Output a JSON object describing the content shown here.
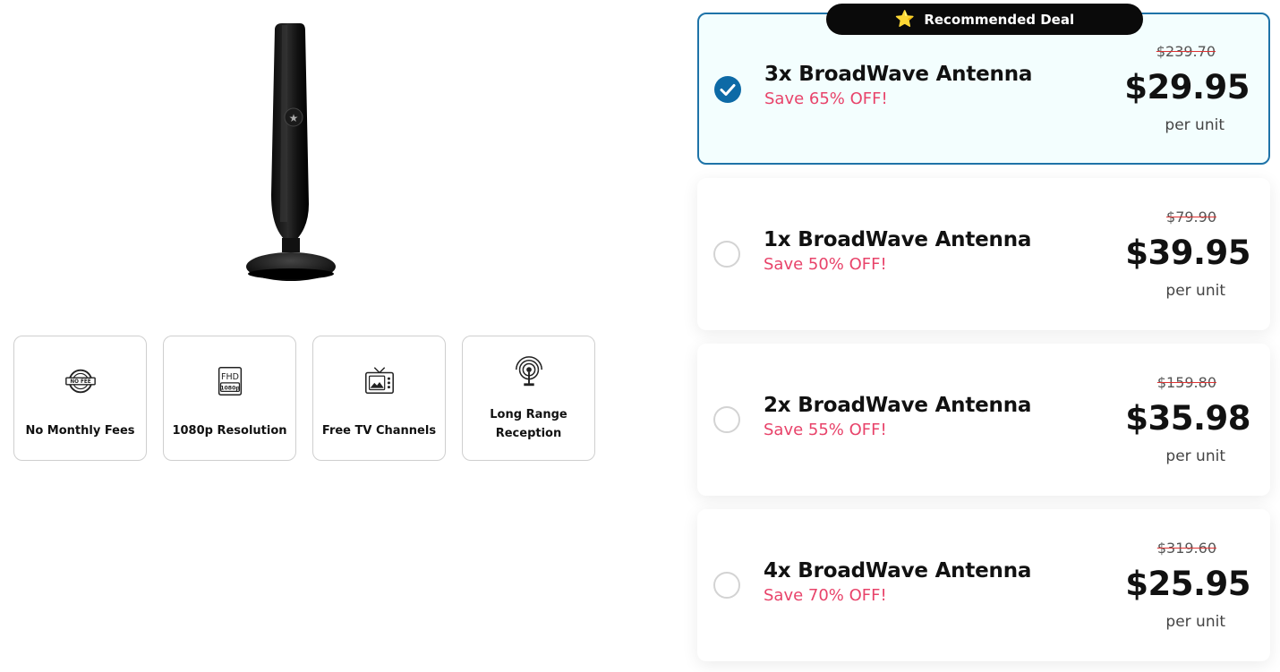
{
  "product": {
    "image_icon": "antenna-product-image"
  },
  "features": [
    {
      "label": "No Monthly Fees",
      "icon": "no-fee-icon"
    },
    {
      "label": "1080p Resolution",
      "icon": "fhd-1080p-icon"
    },
    {
      "label": "Free TV Channels",
      "icon": "tv-icon"
    },
    {
      "label_line1": "Long Range",
      "label_line2": "Reception",
      "icon": "signal-antenna-icon"
    }
  ],
  "badge": {
    "star": "⭐",
    "label": "Recommended Deal"
  },
  "offers": [
    {
      "title": "3x BroadWave Antenna",
      "save": "Save 65% OFF!",
      "old_price": "$239.70",
      "price": "$29.95",
      "unit": "per unit",
      "selected": true
    },
    {
      "title": "1x BroadWave Antenna",
      "save": "Save 50% OFF!",
      "old_price": "$79.90",
      "price": "$39.95",
      "unit": "per unit",
      "selected": false
    },
    {
      "title": "2x BroadWave Antenna",
      "save": "Save 55% OFF!",
      "old_price": "$159.80",
      "price": "$35.98",
      "unit": "per unit",
      "selected": false
    },
    {
      "title": "4x BroadWave Antenna",
      "save": "Save 70% OFF!",
      "old_price": "$319.60",
      "price": "$25.95",
      "unit": "per unit",
      "selected": false
    }
  ],
  "colors": {
    "accent_blue": "#0d6aa6",
    "selected_border": "#1e73a8",
    "selected_bg": "#f3fefe",
    "save_text": "#e8436a",
    "badge_bg": "#0a0a0a",
    "badge_star": "#f6c21b"
  }
}
